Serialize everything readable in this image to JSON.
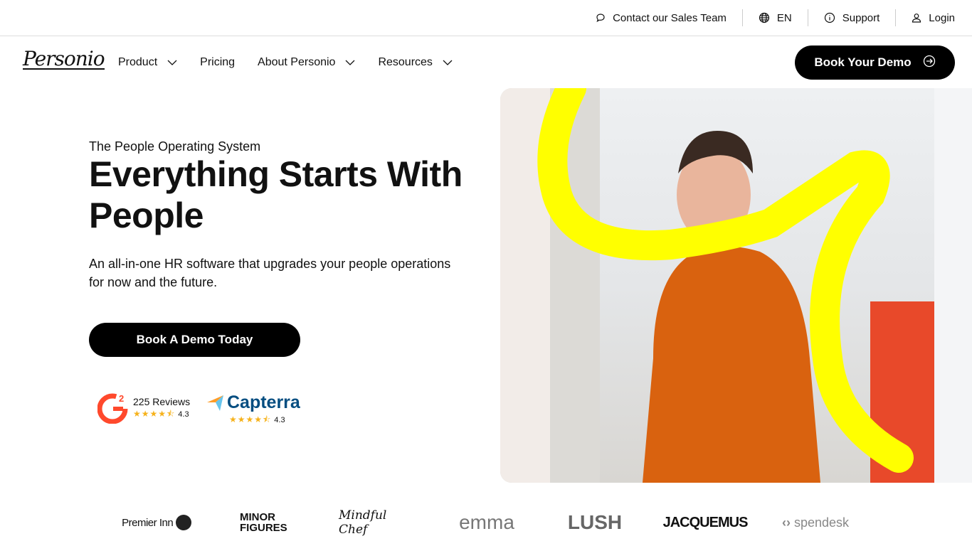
{
  "topbar": {
    "contact": "Contact our Sales Team",
    "language": "EN",
    "support": "Support",
    "login": "Login"
  },
  "nav": {
    "logo": "Personio",
    "items": [
      {
        "label": "Product",
        "dropdown": true
      },
      {
        "label": "Pricing",
        "dropdown": false
      },
      {
        "label": "About Personio",
        "dropdown": true
      },
      {
        "label": "Resources",
        "dropdown": true
      }
    ],
    "cta": "Book Your Demo"
  },
  "hero": {
    "eyebrow": "The People Operating System",
    "title": "Everything Starts With People",
    "subtitle": "An all-in-one HR software that upgrades your people operations for now and the future.",
    "cta": "Book A Demo Today"
  },
  "ratings": [
    {
      "brand": "G2",
      "reviews": "225 Reviews",
      "stars": "★★★★⯪",
      "score": "4.3"
    },
    {
      "brand": "Capterra",
      "stars": "★★★★⯪",
      "score": "4.3"
    }
  ],
  "customers": [
    "Premier Inn",
    "MINOR FIGURES",
    "Mindful Chef",
    "emma",
    "LUSH",
    "JACQUEMUS",
    "spendesk"
  ],
  "colors": {
    "accent": "#ffff00",
    "primary": "#000000",
    "g2": "#ff492c",
    "capterra": "#044d80"
  }
}
